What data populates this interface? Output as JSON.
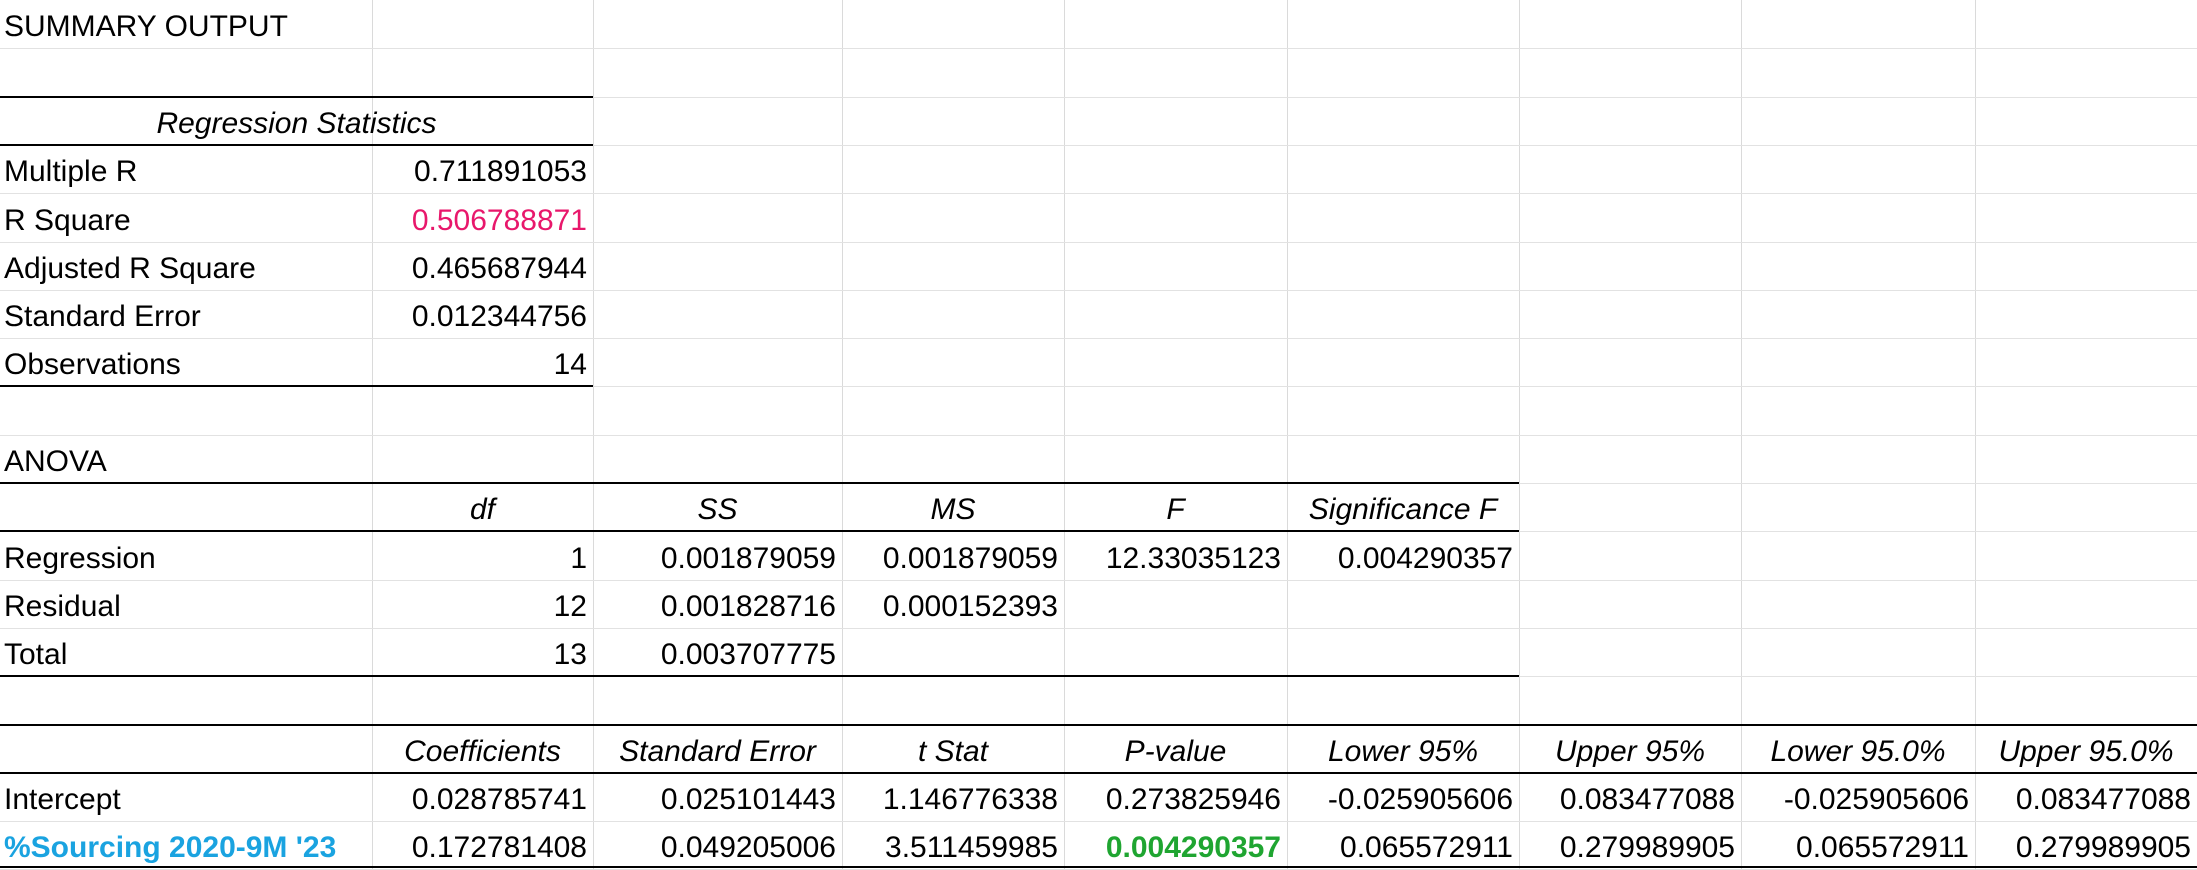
{
  "sheet": {
    "colors": {
      "r_square_value": "#e8176b",
      "predictor_label": "#1aa3e0",
      "p_value_highlight": "#1fa531",
      "gridline": "#dadada",
      "border": "#000000"
    },
    "title": "SUMMARY OUTPUT",
    "regression_statistics": {
      "header": "Regression Statistics",
      "rows": [
        {
          "label": "Multiple R",
          "value": "0.711891053"
        },
        {
          "label": "R Square",
          "value": "0.506788871"
        },
        {
          "label": "Adjusted R Square",
          "value": "0.465687944"
        },
        {
          "label": "Standard Error",
          "value": "0.012344756"
        },
        {
          "label": "Observations",
          "value": "14"
        }
      ]
    },
    "anova": {
      "title": "ANOVA",
      "headers": [
        "df",
        "SS",
        "MS",
        "F",
        "Significance F"
      ],
      "rows": [
        {
          "label": "Regression",
          "cells": [
            "1",
            "0.001879059",
            "0.001879059",
            "12.33035123",
            "0.004290357"
          ]
        },
        {
          "label": "Residual",
          "cells": [
            "12",
            "0.001828716",
            "0.000152393",
            "",
            ""
          ]
        },
        {
          "label": "Total",
          "cells": [
            "13",
            "0.003707775",
            "",
            "",
            ""
          ]
        }
      ]
    },
    "coefficients": {
      "headers": [
        "Coefficients",
        "Standard Error",
        "t Stat",
        "P-value",
        "Lower 95%",
        "Upper 95%",
        "Lower 95.0%",
        "Upper 95.0%"
      ],
      "rows": [
        {
          "label": "Intercept",
          "cells": [
            "0.028785741",
            "0.025101443",
            "1.146776338",
            "0.273825946",
            "-0.025905606",
            "0.083477088",
            "-0.025905606",
            "0.083477088"
          ]
        },
        {
          "label": "%Sourcing 2020-9M '23",
          "cells": [
            "0.172781408",
            "0.049205006",
            "3.511459985",
            "0.004290357",
            "0.065572911",
            "0.279989905",
            "0.065572911",
            "0.279989905"
          ]
        }
      ]
    }
  }
}
